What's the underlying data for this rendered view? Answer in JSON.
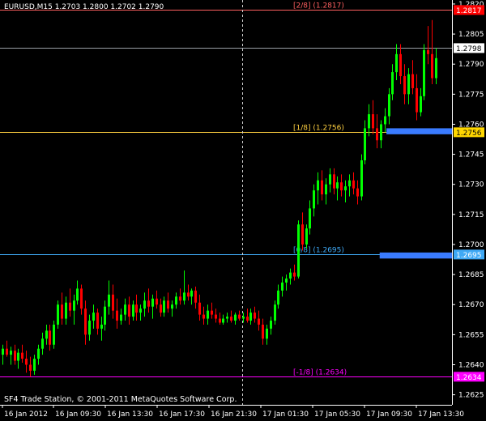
{
  "chart_title": "EURUSD,M15  1.2703 1.2800 1.2702 1.2790",
  "footer": "SF4 Trade Station, © 2001-2011 MetaQuotes Software Corp.",
  "colors": {
    "background": "#000000",
    "bull": "#00ff00",
    "bear": "#ff0000",
    "axis": "#ffffff"
  },
  "chart_data": {
    "type": "candlestick",
    "symbol": "EURUSD",
    "timeframe": "M15",
    "ohlc_header": {
      "open": 1.2703,
      "high": 1.28,
      "low": 1.2702,
      "close": 1.279
    },
    "ylim": [
      1.262,
      1.2822
    ],
    "y_ticks": [
      "1.2820",
      "1.2805",
      "1.2790",
      "1.2775",
      "1.2760",
      "1.2745",
      "1.2730",
      "1.2715",
      "1.2700",
      "1.2685",
      "1.2670",
      "1.2655",
      "1.2640",
      "1.2625"
    ],
    "x_ticks": [
      "16 Jan 2012",
      "16 Jan 09:30",
      "16 Jan 13:30",
      "16 Jan 17:30",
      "16 Jan 21:30",
      "17 Jan 01:30",
      "17 Jan 05:30",
      "17 Jan 09:30",
      "17 Jan 13:30"
    ],
    "levels": [
      {
        "label": "[2/8]  (1.2817)",
        "price": 1.2817,
        "axis_label": "1.2817",
        "color": "#ff6060",
        "tag_bg": "#ff0000"
      },
      {
        "label": "[1/8]  (1.2756)",
        "price": 1.2756,
        "axis_label": "1.2756",
        "color": "#ffd040",
        "tag_bg": "#ffd700"
      },
      {
        "label": "[0/8]  (1.2695)",
        "price": 1.2695,
        "axis_label": "1.2695",
        "color": "#3fa9f5",
        "tag_bg": "#3fa9f5"
      },
      {
        "label": "[-1/8]  (1.2634)",
        "price": 1.2634,
        "axis_label": "1.2634",
        "color": "#ff00ff",
        "tag_bg": "#ff00ff"
      }
    ],
    "current_price": {
      "price": 1.2798,
      "axis_label": "1.2798"
    },
    "zones": [
      {
        "price_top": 1.2758,
        "price_bottom": 1.2755,
        "x_start": 0.855,
        "x_end": 1.0,
        "color": "#3a7bff"
      },
      {
        "price_top": 1.2696,
        "price_bottom": 1.2693,
        "x_start": 0.84,
        "x_end": 1.0,
        "color": "#3a7bff"
      }
    ],
    "separator_x": 0.535,
    "candles": [
      [
        1.2645,
        1.265,
        1.264,
        1.2648
      ],
      [
        1.2648,
        1.2652,
        1.2644,
        1.2645
      ],
      [
        1.2645,
        1.2649,
        1.264,
        1.2647
      ],
      [
        1.2647,
        1.265,
        1.264,
        1.2642
      ],
      [
        1.2642,
        1.2648,
        1.2638,
        1.2646
      ],
      [
        1.2646,
        1.265,
        1.2641,
        1.2643
      ],
      [
        1.2643,
        1.2647,
        1.2636,
        1.264
      ],
      [
        1.264,
        1.2644,
        1.2634,
        1.2637
      ],
      [
        1.2637,
        1.2645,
        1.2635,
        1.2643
      ],
      [
        1.2643,
        1.265,
        1.264,
        1.2648
      ],
      [
        1.2648,
        1.2656,
        1.2645,
        1.2653
      ],
      [
        1.2653,
        1.266,
        1.265,
        1.2657
      ],
      [
        1.2657,
        1.266,
        1.2647,
        1.265
      ],
      [
        1.265,
        1.2662,
        1.2648,
        1.266
      ],
      [
        1.266,
        1.2672,
        1.2658,
        1.267
      ],
      [
        1.267,
        1.2676,
        1.266,
        1.2663
      ],
      [
        1.2663,
        1.2674,
        1.266,
        1.2671
      ],
      [
        1.2671,
        1.2678,
        1.2664,
        1.2667
      ],
      [
        1.2667,
        1.2675,
        1.266,
        1.2672
      ],
      [
        1.2672,
        1.2682,
        1.267,
        1.2678
      ],
      [
        1.2678,
        1.268,
        1.2665,
        1.2668
      ],
      [
        1.2668,
        1.2672,
        1.265,
        1.2655
      ],
      [
        1.2655,
        1.2665,
        1.2652,
        1.2662
      ],
      [
        1.2662,
        1.267,
        1.2658,
        1.2666
      ],
      [
        1.2666,
        1.2668,
        1.2655,
        1.2658
      ],
      [
        1.2658,
        1.2664,
        1.2652,
        1.266
      ],
      [
        1.266,
        1.2672,
        1.2657,
        1.2669
      ],
      [
        1.2669,
        1.2682,
        1.2665,
        1.2675
      ],
      [
        1.2675,
        1.268,
        1.2663,
        1.2667
      ],
      [
        1.2667,
        1.2673,
        1.2658,
        1.2662
      ],
      [
        1.2662,
        1.2668,
        1.266,
        1.2665
      ],
      [
        1.2665,
        1.2673,
        1.2662,
        1.267
      ],
      [
        1.267,
        1.2674,
        1.266,
        1.2664
      ],
      [
        1.2664,
        1.2672,
        1.2662,
        1.267
      ],
      [
        1.267,
        1.2675,
        1.2662,
        1.2666
      ],
      [
        1.2666,
        1.267,
        1.2662,
        1.2668
      ],
      [
        1.2668,
        1.2676,
        1.2664,
        1.2672
      ],
      [
        1.2672,
        1.2678,
        1.2666,
        1.2669
      ],
      [
        1.2669,
        1.2675,
        1.2663,
        1.2673
      ],
      [
        1.2673,
        1.2677,
        1.2668,
        1.267
      ],
      [
        1.267,
        1.2673,
        1.2664,
        1.2666
      ],
      [
        1.2666,
        1.2674,
        1.2664,
        1.2672
      ],
      [
        1.2672,
        1.2676,
        1.2666,
        1.2668
      ],
      [
        1.2668,
        1.2672,
        1.2664,
        1.267
      ],
      [
        1.267,
        1.2676,
        1.2668,
        1.2674
      ],
      [
        1.2674,
        1.2678,
        1.267,
        1.2672
      ],
      [
        1.2672,
        1.2687,
        1.267,
        1.2676
      ],
      [
        1.2676,
        1.268,
        1.2672,
        1.2674
      ],
      [
        1.2674,
        1.2678,
        1.267,
        1.2677
      ],
      [
        1.2677,
        1.2679,
        1.2668,
        1.2671
      ],
      [
        1.2671,
        1.2675,
        1.2662,
        1.2665
      ],
      [
        1.2665,
        1.2669,
        1.266,
        1.2663
      ],
      [
        1.2663,
        1.267,
        1.266,
        1.2667
      ],
      [
        1.2667,
        1.2671,
        1.2663,
        1.2665
      ],
      [
        1.2665,
        1.2668,
        1.2661,
        1.2663
      ],
      [
        1.2663,
        1.2666,
        1.266,
        1.2661
      ],
      [
        1.2661,
        1.2665,
        1.266,
        1.2663
      ],
      [
        1.2663,
        1.2666,
        1.2661,
        1.2664
      ],
      [
        1.2664,
        1.2667,
        1.2661,
        1.2662
      ],
      [
        1.2662,
        1.2666,
        1.266,
        1.2665
      ],
      [
        1.2665,
        1.2667,
        1.2662,
        1.2663
      ],
      [
        1.2663,
        1.2666,
        1.2661,
        1.2664
      ],
      [
        1.2664,
        1.2668,
        1.2661,
        1.2662
      ],
      [
        1.2662,
        1.2668,
        1.266,
        1.2666
      ],
      [
        1.2666,
        1.2669,
        1.2661,
        1.2663
      ],
      [
        1.2663,
        1.2667,
        1.2657,
        1.266
      ],
      [
        1.266,
        1.2663,
        1.265,
        1.2653
      ],
      [
        1.2653,
        1.266,
        1.265,
        1.2658
      ],
      [
        1.2658,
        1.2664,
        1.2655,
        1.2662
      ],
      [
        1.2662,
        1.2672,
        1.266,
        1.267
      ],
      [
        1.267,
        1.268,
        1.2668,
        1.2677
      ],
      [
        1.2677,
        1.2684,
        1.2674,
        1.2681
      ],
      [
        1.2681,
        1.2685,
        1.2677,
        1.2683
      ],
      [
        1.2683,
        1.2688,
        1.268,
        1.2686
      ],
      [
        1.2686,
        1.269,
        1.2682,
        1.2684
      ],
      [
        1.2684,
        1.2712,
        1.2683,
        1.271
      ],
      [
        1.271,
        1.2716,
        1.2697,
        1.27
      ],
      [
        1.27,
        1.271,
        1.2698,
        1.2708
      ],
      [
        1.2708,
        1.2722,
        1.2705,
        1.2718
      ],
      [
        1.2718,
        1.273,
        1.2714,
        1.2727
      ],
      [
        1.2727,
        1.2736,
        1.272,
        1.2732
      ],
      [
        1.2732,
        1.2737,
        1.2722,
        1.2725
      ],
      [
        1.2725,
        1.2733,
        1.272,
        1.273
      ],
      [
        1.273,
        1.2738,
        1.2726,
        1.2735
      ],
      [
        1.2735,
        1.2738,
        1.2725,
        1.2728
      ],
      [
        1.2728,
        1.2734,
        1.2722,
        1.2731
      ],
      [
        1.2731,
        1.2735,
        1.2724,
        1.2727
      ],
      [
        1.2727,
        1.2732,
        1.2721,
        1.2729
      ],
      [
        1.2729,
        1.2735,
        1.2724,
        1.2732
      ],
      [
        1.2732,
        1.2736,
        1.2725,
        1.2728
      ],
      [
        1.2728,
        1.2732,
        1.272,
        1.2724
      ],
      [
        1.2724,
        1.2745,
        1.2722,
        1.2742
      ],
      [
        1.2742,
        1.2762,
        1.274,
        1.2758
      ],
      [
        1.2758,
        1.277,
        1.2754,
        1.2765
      ],
      [
        1.2765,
        1.2772,
        1.2755,
        1.2758
      ],
      [
        1.2758,
        1.2765,
        1.2748,
        1.2752
      ],
      [
        1.2752,
        1.2762,
        1.2748,
        1.276
      ],
      [
        1.276,
        1.2768,
        1.2756,
        1.2764
      ],
      [
        1.2764,
        1.2778,
        1.276,
        1.2775
      ],
      [
        1.2775,
        1.279,
        1.2772,
        1.2786
      ],
      [
        1.2786,
        1.28,
        1.2782,
        1.2795
      ],
      [
        1.2795,
        1.28,
        1.278,
        1.2784
      ],
      [
        1.2784,
        1.279,
        1.277,
        1.2775
      ],
      [
        1.2775,
        1.2788,
        1.277,
        1.2785
      ],
      [
        1.2785,
        1.2792,
        1.2775,
        1.2778
      ],
      [
        1.2778,
        1.2785,
        1.2762,
        1.2766
      ],
      [
        1.2766,
        1.2778,
        1.2764,
        1.2774
      ],
      [
        1.2774,
        1.28,
        1.2772,
        1.2797
      ],
      [
        1.2797,
        1.2809,
        1.279,
        1.2795
      ],
      [
        1.2795,
        1.2812,
        1.278,
        1.2783
      ],
      [
        1.2783,
        1.2798,
        1.278,
        1.2793
      ]
    ]
  }
}
